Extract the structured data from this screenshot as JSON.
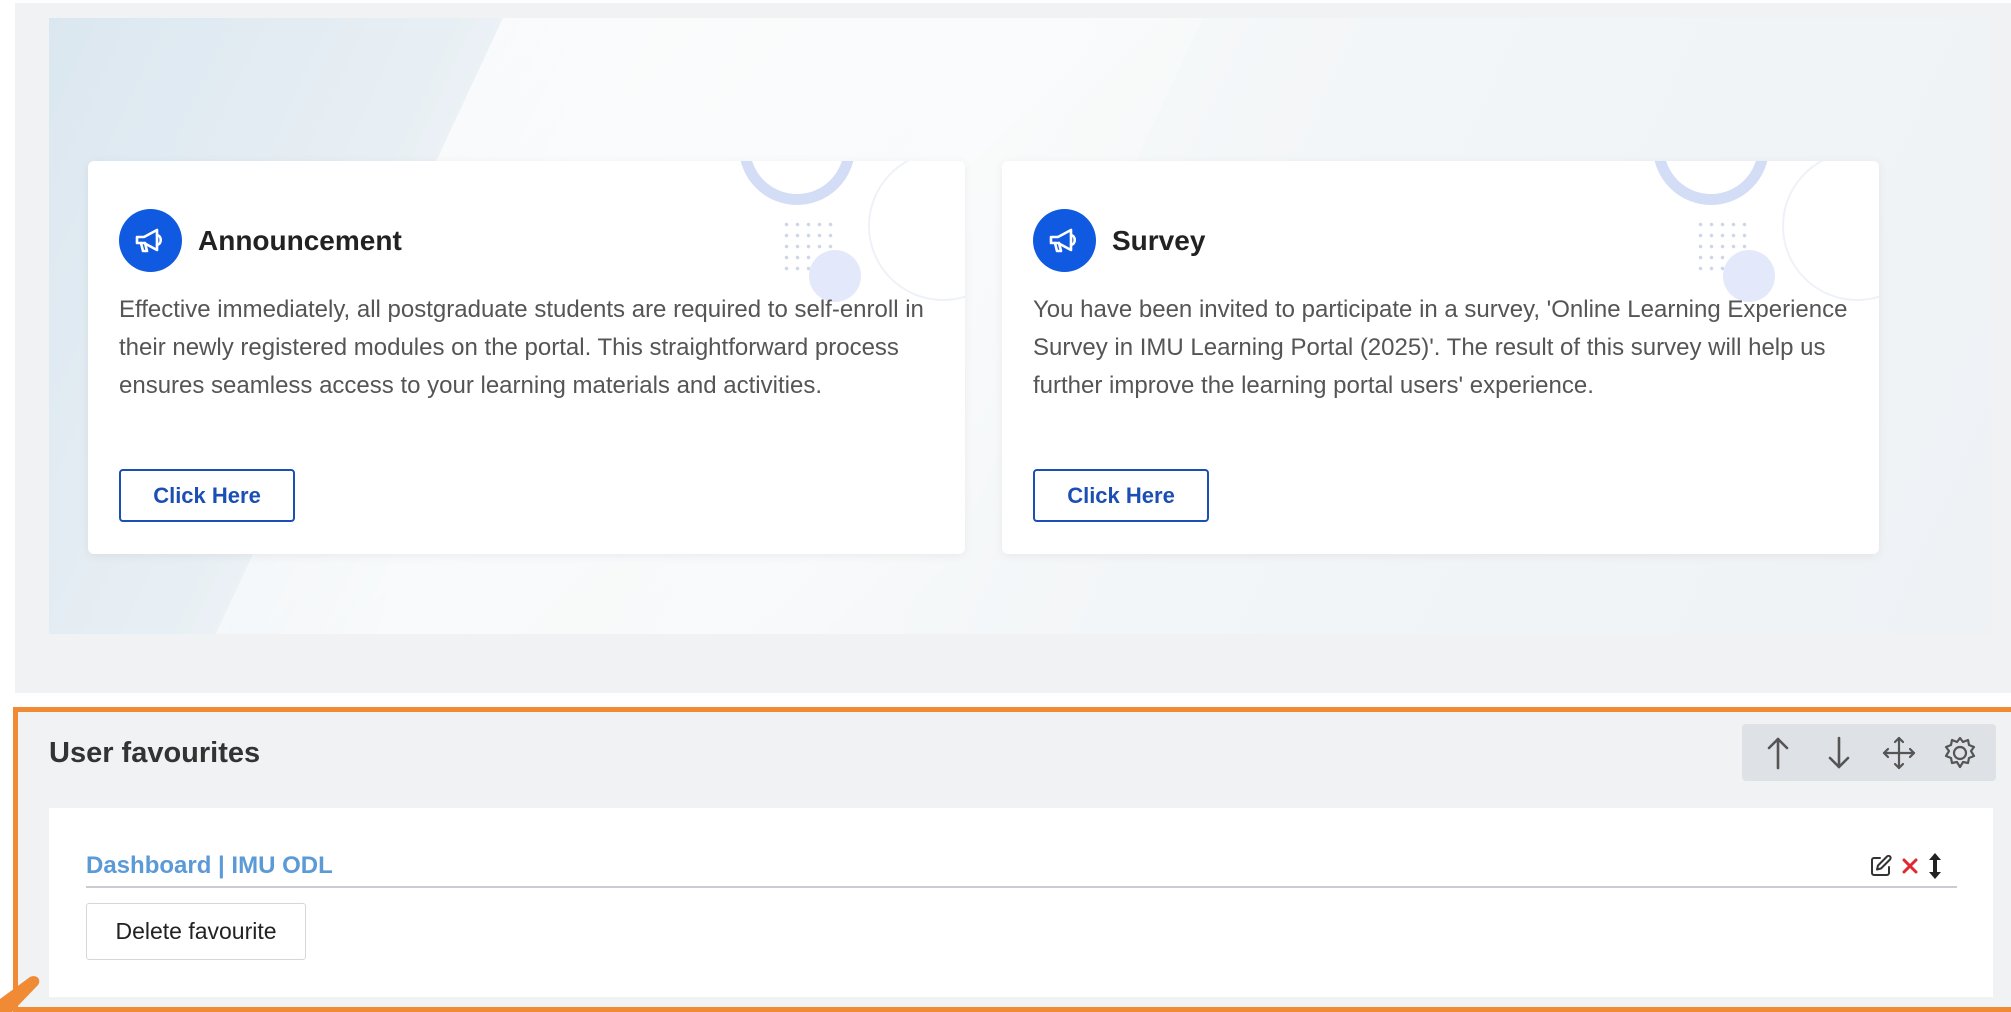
{
  "announcements": [
    {
      "title": "Announcement",
      "icon": "megaphone-icon",
      "text": "Effective immediately, all postgraduate students are required to self-enroll in their newly registered modules on the portal. This straightforward process ensures seamless access to your learning materials and activities.",
      "button_label": "Click Here"
    },
    {
      "title": "Survey",
      "icon": "megaphone-icon",
      "text": "You have been invited to participate in a survey, 'Online Learning Experience Survey in IMU Learning Portal (2025)'. The result of this survey will help us further improve the learning portal users' experience.",
      "button_label": "Click Here"
    }
  ],
  "user_favourites": {
    "title": "User favourites",
    "controls": [
      "arrow-up-icon",
      "arrow-down-icon",
      "move-icon",
      "settings-icon"
    ],
    "items": [
      {
        "label": "Dashboard | IMU ODL",
        "actions": [
          "edit-icon",
          "delete-x-icon",
          "drag-vertical-icon"
        ]
      }
    ],
    "delete_button_label": "Delete favourite"
  },
  "colors": {
    "accent_blue": "#0f5ae0",
    "button_border": "#1c4fb3",
    "link_blue": "#5b9ad6",
    "highlight_orange": "#f18a34",
    "delete_red": "#e0282e"
  }
}
